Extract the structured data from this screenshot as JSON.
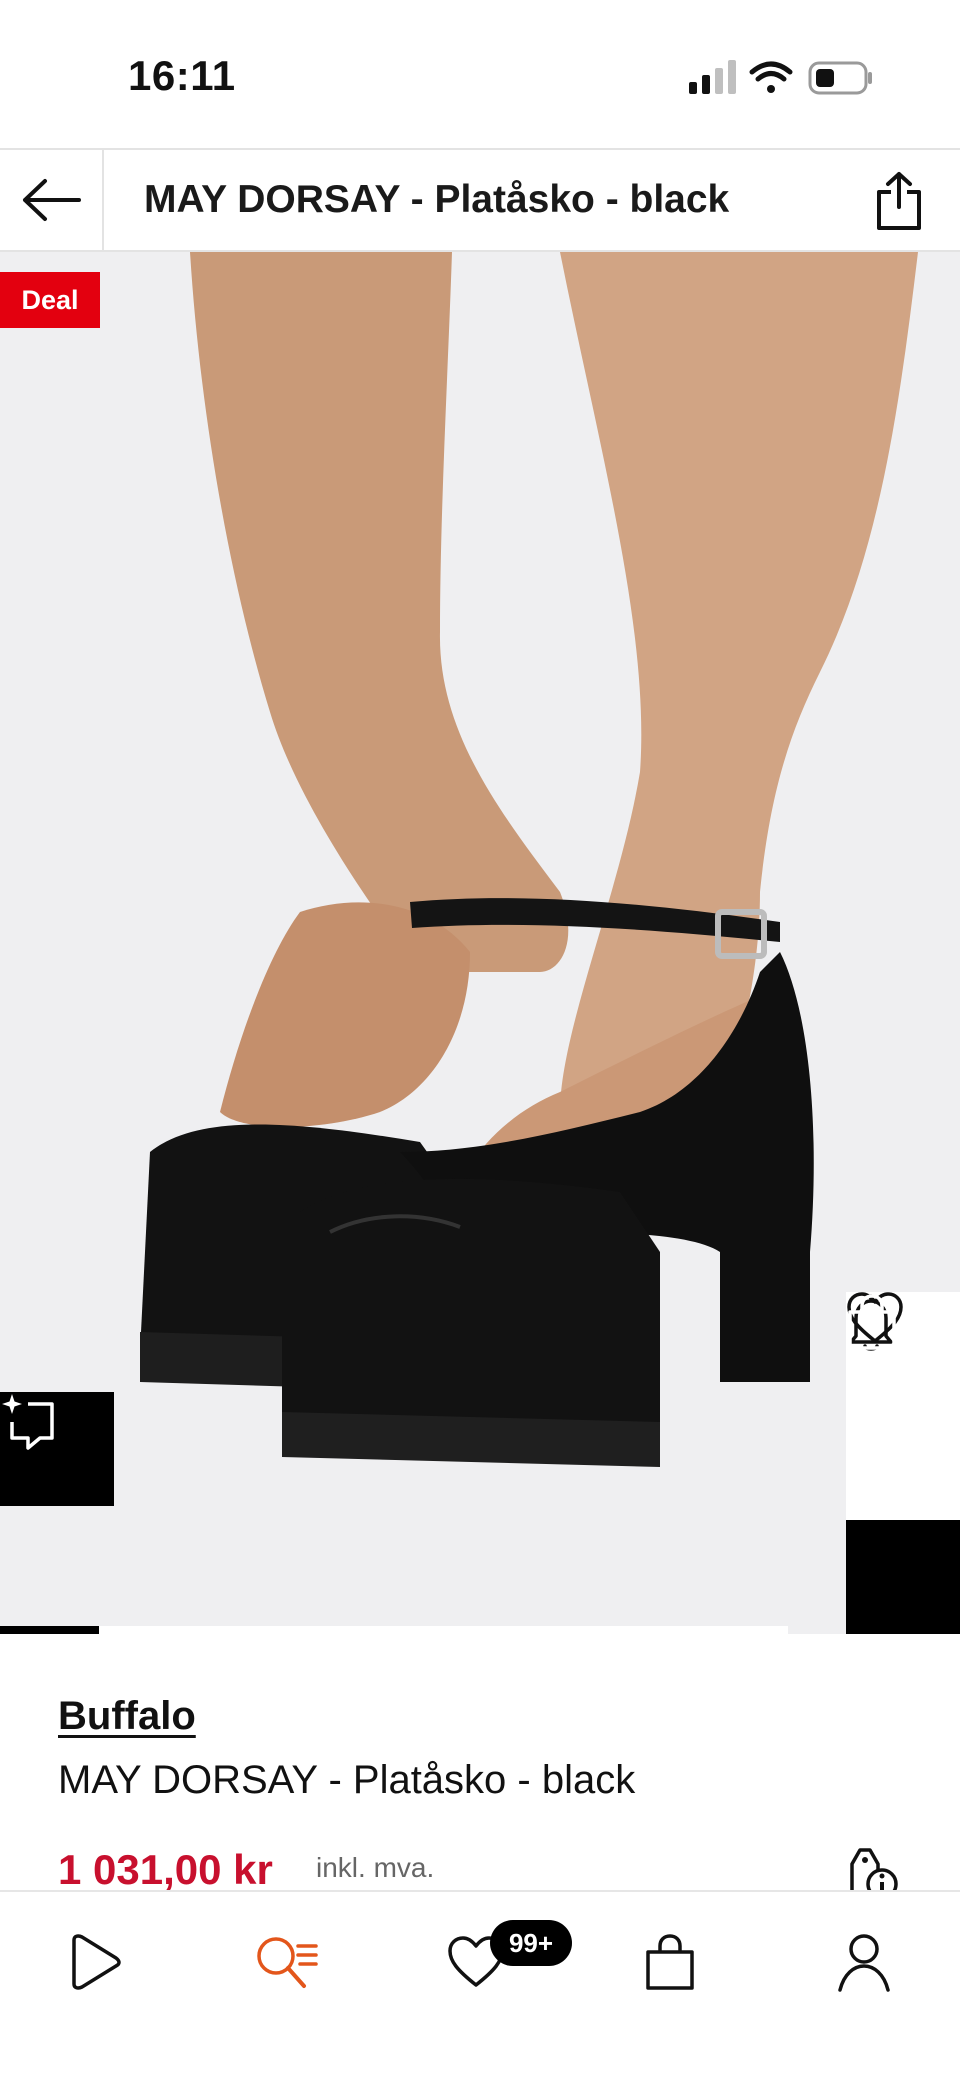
{
  "status_bar": {
    "time": "16:11"
  },
  "header": {
    "title": "MAY DORSAY - Platåsko - black",
    "back_icon": "arrow-left-icon",
    "share_icon": "share-icon"
  },
  "hero": {
    "badge": "Deal",
    "gallery_progress": 0.125,
    "similar_icon": "sparkle-frame-icon",
    "side_actions": [
      "bell-icon",
      "heart-icon",
      "shopping-bag-icon"
    ]
  },
  "product": {
    "brand": "Buffalo",
    "name": "MAY DORSAY - Platåsko - black",
    "price": "1 031,00 kr",
    "price_note": "inkl. mva."
  },
  "bottom_nav": {
    "items": [
      "home-play-icon",
      "search-list-icon",
      "heart-icon",
      "bag-icon",
      "profile-icon"
    ],
    "wishlist_badge": "99+"
  },
  "colors": {
    "accent_red": "#e3000f",
    "price_red": "#c8102e",
    "active_nav": "#e3561b"
  }
}
